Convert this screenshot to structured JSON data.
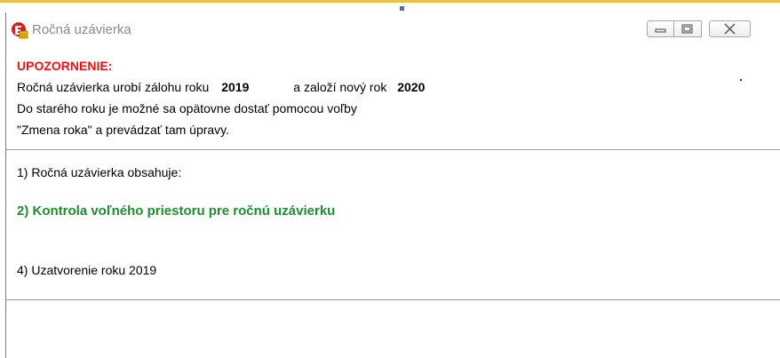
{
  "window": {
    "title": "Ročná uzávierka",
    "icon": "app-logo-icon",
    "controls": {
      "minimize": "minimize-icon",
      "maximize": "maximize-icon",
      "close": "close-icon"
    }
  },
  "notice": {
    "heading": "UPOZORNENIE:",
    "line1_prefix": "Ročná uzávierka urobí zálohu roku",
    "line1_year_old": "2019",
    "line1_middle": "a založí nový rok",
    "line1_year_new": "2020",
    "line2": "Do starého roku je možné sa opätovne dostať pomocou voľby",
    "line3": "\"Zmena roka\" a prevádzať tam úpravy."
  },
  "steps": [
    {
      "label": "1) Ročná uzávierka obsahuje:",
      "state": "normal"
    },
    {
      "label": "2) Kontrola voľného priestoru pre ročnú uzávierku",
      "state": "active"
    },
    {
      "label": "4) Uzatvorenie roku 2019",
      "state": "normal"
    }
  ],
  "colors": {
    "warning": "#ee1111",
    "active_step": "#1a8f2a",
    "title_text": "#8a8a8a",
    "top_border": "#e8c04a"
  }
}
